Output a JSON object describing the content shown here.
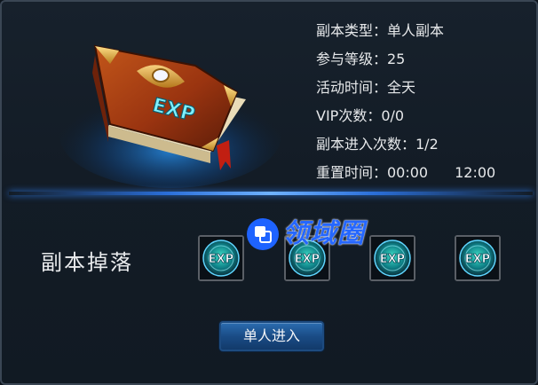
{
  "info": {
    "dungeon_type": "副本类型：单人副本",
    "required_level": "参与等级：25",
    "activity_time": "活动时间：全天",
    "vip_times": "VIP次数：0/0",
    "entry_count": "副本进入次数：1/2",
    "reset_time_label": "重置时间：00:00",
    "reset_time_second": "12:00"
  },
  "drops": {
    "title": "副本掉落",
    "items": [
      {
        "icon": "exp-orb-icon",
        "label": "EXP"
      },
      {
        "icon": "exp-orb-icon",
        "label": "EXP"
      },
      {
        "icon": "exp-orb-icon",
        "label": "EXP"
      },
      {
        "icon": "exp-orb-icon",
        "label": "EXP"
      }
    ]
  },
  "book": {
    "icon": "exp-book-icon",
    "label": "EXP"
  },
  "enter_button": {
    "label": "单人进入"
  },
  "watermark": {
    "text": "领域圈"
  },
  "colors": {
    "panel_bg": "#131c26",
    "divider_glow": "#2f7be8",
    "button_blue": "#1a4c86",
    "text": "#e6e8ea",
    "watermark_blue": "#2567ff",
    "exp_cyan": "#7ff1ff"
  }
}
